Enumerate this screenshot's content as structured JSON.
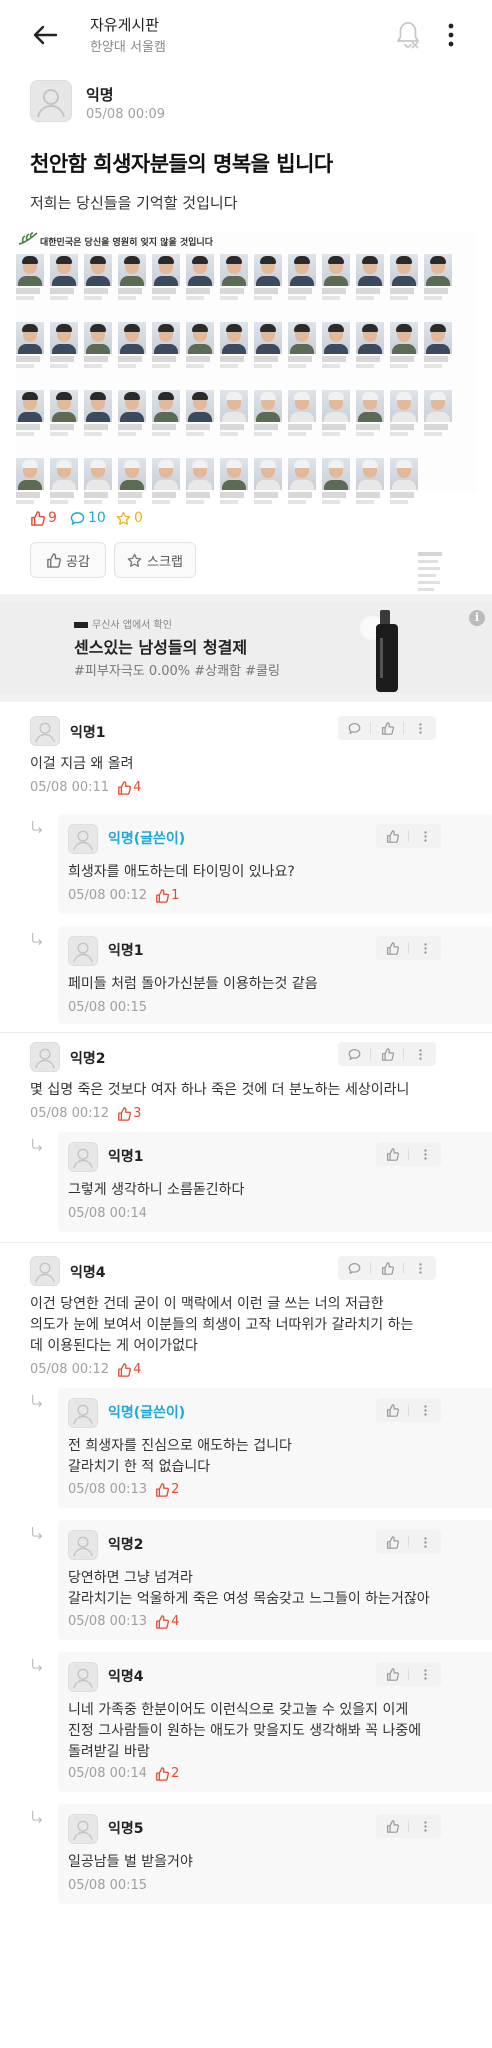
{
  "header": {
    "board": "자유게시판",
    "school": "한양대 서울캠"
  },
  "post": {
    "author": "익명",
    "time": "05/08 00:09",
    "title": "천안함 희생자분들의 명복을 빕니다",
    "body": "저희는 당신들을 기억할 것입니다",
    "image_caption": "대한민국은 당신을 영원히 잊지 않을 것입니다",
    "likes": "9",
    "comments": "10",
    "scraps": "0",
    "like_button": "공감",
    "scrap_button": "스크랩"
  },
  "ad": {
    "brand": "무신사 앱에서 확인",
    "title": "센스있는 남성들의 청결제",
    "tags": "#피부자극도 0.00% #상쾌함 #쿨링",
    "info": "i"
  },
  "comments": [
    {
      "author": "익명1",
      "text": "이걸 지금 왜 올려",
      "time": "05/08 00:11",
      "likes": "4"
    },
    {
      "author": "익명(글쓴이)",
      "text": "희생자를 애도하는데 타이밍이 있나요?",
      "time": "05/08 00:12",
      "likes": "1"
    },
    {
      "author": "익명1",
      "text": "페미들 처럼 돌아가신분들 이용하는것 같음",
      "time": "05/08 00:15",
      "likes": ""
    },
    {
      "author": "익명2",
      "text": "몇 십명 죽은 것보다 여자 하나 죽은 것에 더 분노하는 세상이라니",
      "time": "05/08 00:12",
      "likes": "3"
    },
    {
      "author": "익명1",
      "text": "그렇게 생각하니 소름돋긴하다",
      "time": "05/08 00:14",
      "likes": ""
    },
    {
      "author": "익명4",
      "text": "이건 당연한 건데 굳이 이 맥락에서 이런 글 쓰는 너의 저급한\n의도가 눈에 보여서 이분들의 희생이 고작 너따위가 갈라치기 하는\n데 이용된다는 게 어이가없다",
      "time": "05/08 00:12",
      "likes": "4"
    },
    {
      "author": "익명(글쓴이)",
      "text": "전 희생자를 진심으로 애도하는 겁니다\n갈라치기 한 적 없습니다",
      "time": "05/08 00:13",
      "likes": "2"
    },
    {
      "author": "익명2",
      "text": "당연하면 그냥 넘겨라\n갈라치기는 억울하게 죽은 여성 목숨갖고 느그들이 하는거잖아",
      "time": "05/08 00:13",
      "likes": "4"
    },
    {
      "author": "익명4",
      "text": "니네 가족중 한분이어도 이런식으로 갖고놀 수 있을지 이게\n진정 그사람들이 원하는 애도가 맞을지도 생각해봐 꼭 나중에\n돌려받길 바람",
      "time": "05/08 00:14",
      "likes": "2"
    },
    {
      "author": "익명5",
      "text": "일공남들 벌 받을거야",
      "time": "05/08 00:15",
      "likes": ""
    }
  ]
}
